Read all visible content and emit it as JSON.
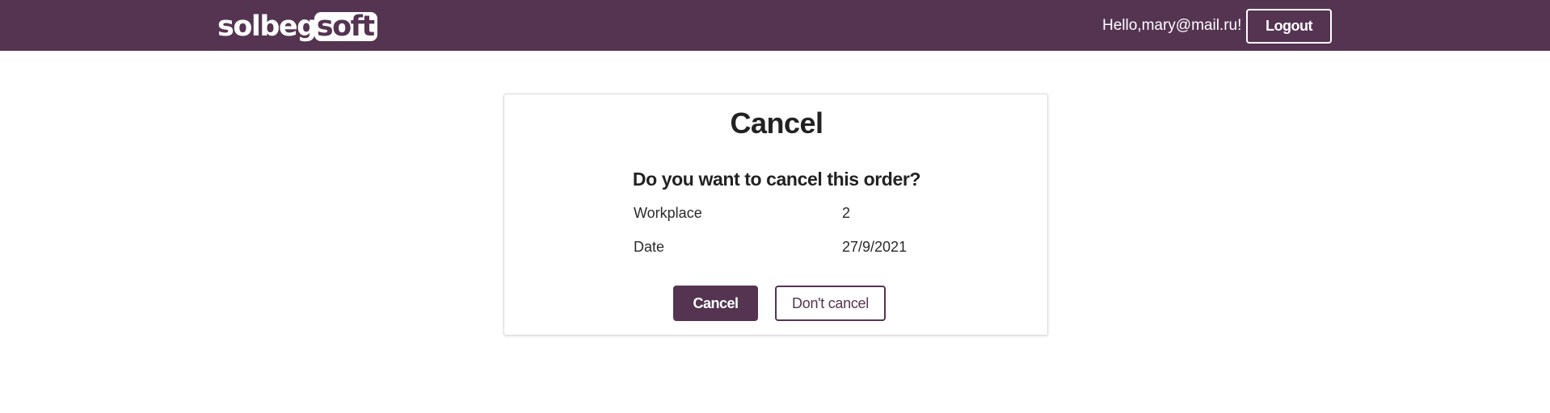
{
  "header": {
    "logo": {
      "left_text": "solbeg",
      "right_text": "soft"
    },
    "greeting": "Hello,mary@mail.ru!",
    "logout_label": "Logout"
  },
  "dialog": {
    "title": "Cancel",
    "question": "Do you want to cancel this order?",
    "details": [
      {
        "label": "Workplace",
        "value": "2"
      },
      {
        "label": "Date",
        "value": "27/9/2021"
      }
    ],
    "confirm_label": "Cancel",
    "dismiss_label": "Don't cancel"
  },
  "colors": {
    "brand": "#553452",
    "background": "#ffffff",
    "text": "#2a2a2a"
  }
}
